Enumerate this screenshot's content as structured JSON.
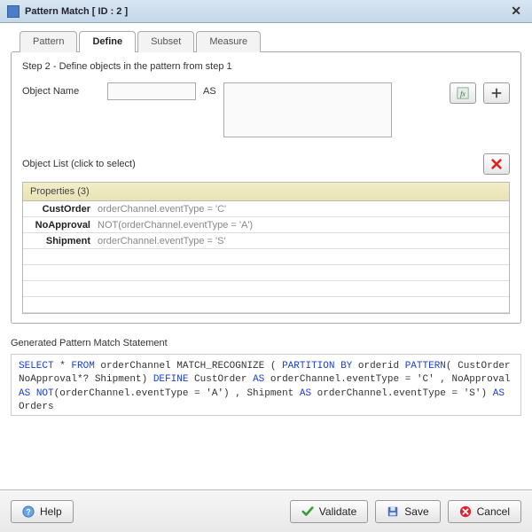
{
  "title": "Pattern Match [ ID : 2 ]",
  "tabs": [
    {
      "label": "Pattern"
    },
    {
      "label": "Define"
    },
    {
      "label": "Subset"
    },
    {
      "label": "Measure"
    }
  ],
  "active_tab_index": 1,
  "step_label": "Step 2 - Define objects in the pattern from step 1",
  "object_name_label": "Object Name",
  "object_name_value": "",
  "as_label": "AS",
  "expression_value": "",
  "fx_title": "Expression builder",
  "plus_title": "Add",
  "object_list_label": "Object List (click to select)",
  "delete_title": "Delete",
  "grid_header": "Properties (3)",
  "grid_rows": [
    {
      "name": "CustOrder",
      "expr": "orderChannel.eventType = 'C'"
    },
    {
      "name": "NoApproval",
      "expr": "NOT(orderChannel.eventType = 'A')"
    },
    {
      "name": "Shipment",
      "expr": "orderChannel.eventType = 'S'"
    }
  ],
  "generated_label": "Generated Pattern Match Statement",
  "generated_statement": {
    "tokens": [
      {
        "kw": true,
        "t": "SELECT"
      },
      {
        "t": " * "
      },
      {
        "kw": true,
        "t": "FROM"
      },
      {
        "t": " orderChannel  MATCH_RECOGNIZE ( "
      },
      {
        "kw": true,
        "t": "PARTITION BY"
      },
      {
        "t": " orderid "
      },
      {
        "kw": true,
        "t": "PATTERN"
      },
      {
        "t": "( CustOrder NoApproval*? Shipment) "
      },
      {
        "kw": true,
        "t": "DEFINE"
      },
      {
        "t": " CustOrder "
      },
      {
        "kw": true,
        "t": "AS"
      },
      {
        "t": " orderChannel.eventType = 'C' , NoApproval "
      },
      {
        "kw": true,
        "t": "AS"
      },
      {
        "t": " "
      },
      {
        "kw": true,
        "t": "NOT"
      },
      {
        "t": "(orderChannel.eventType = 'A') , Shipment "
      },
      {
        "kw": true,
        "t": "AS"
      },
      {
        "t": " orderChannel.eventType = 'S') "
      },
      {
        "kw": true,
        "t": "AS"
      },
      {
        "t": " Orders"
      }
    ]
  },
  "buttons": {
    "help": "Help",
    "validate": "Validate",
    "save": "Save",
    "cancel": "Cancel"
  }
}
